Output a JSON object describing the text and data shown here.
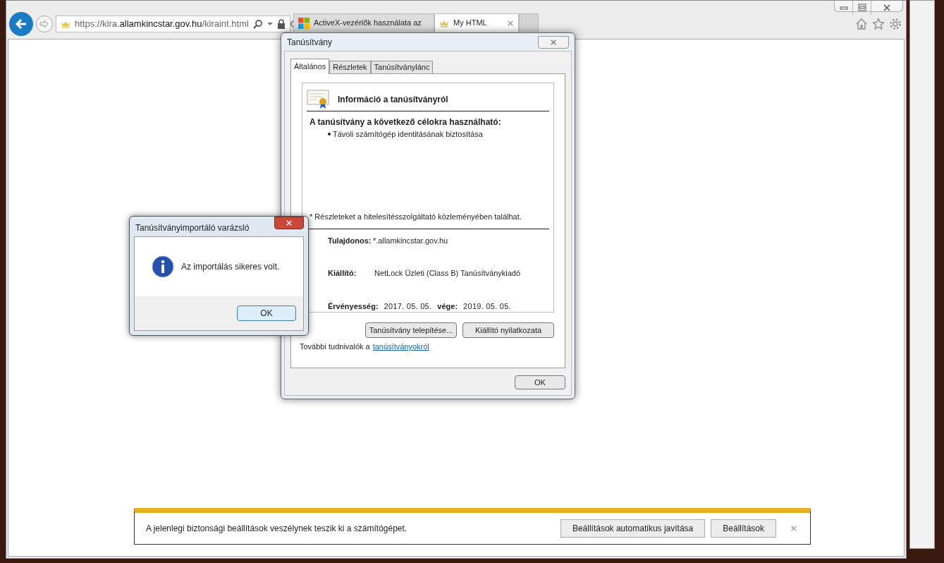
{
  "browser": {
    "address": {
      "scheme": "https://",
      "subdomain": "kira.",
      "domain": "allamkincstar.gov.hu",
      "path": "/kiraint.html"
    },
    "tabs": [
      {
        "title": "ActiveX-vezérlők használata az",
        "selected": false
      },
      {
        "title": "My HTML",
        "selected": true
      }
    ]
  },
  "certificate_dialog": {
    "title": "Tanúsítvány",
    "tabs": [
      {
        "label": "Általános",
        "selected": true
      },
      {
        "label": "Részletek",
        "selected": false
      },
      {
        "label": "Tanúsítványlánc",
        "selected": false
      }
    ],
    "heading": "Információ a tanúsítványról",
    "purposes_heading": "A tanúsítvány a következő célokra használható:",
    "purposes": [
      "Távoli számítógép identitásának biztosítása"
    ],
    "footnote": "* Részleteket a hitelesítésszolgáltató közleményében találhat.",
    "fields": [
      {
        "label": "Tulajdonos:",
        "value": "*.allamkincstar.gov.hu"
      },
      {
        "label": "Kiállító:",
        "value": "NetLock Üzleti (Class B) Tanúsítványkiadó"
      }
    ],
    "validity": {
      "label": "Érvényesség:",
      "from": "2017. 05. 05.",
      "to_label": "vége:",
      "to": "2019. 05. 05."
    },
    "buttons": [
      "Tanúsítvány telepítése...",
      "Kiállító nyilatkozata"
    ],
    "more_info": {
      "text": "További tudnivalók a",
      "link": "tanúsítványokról"
    },
    "ok": "OK"
  },
  "import_dialog": {
    "title": "Tanúsítványimportáló varázsló",
    "message": "Az importálás sikeres volt.",
    "ok": "OK"
  },
  "notification": {
    "message": "A jelenlegi biztonsági beállítások veszélynek teszik ki a számítógépet.",
    "buttons": [
      "Beállítások automatikus javítása",
      "Beállítások"
    ]
  }
}
